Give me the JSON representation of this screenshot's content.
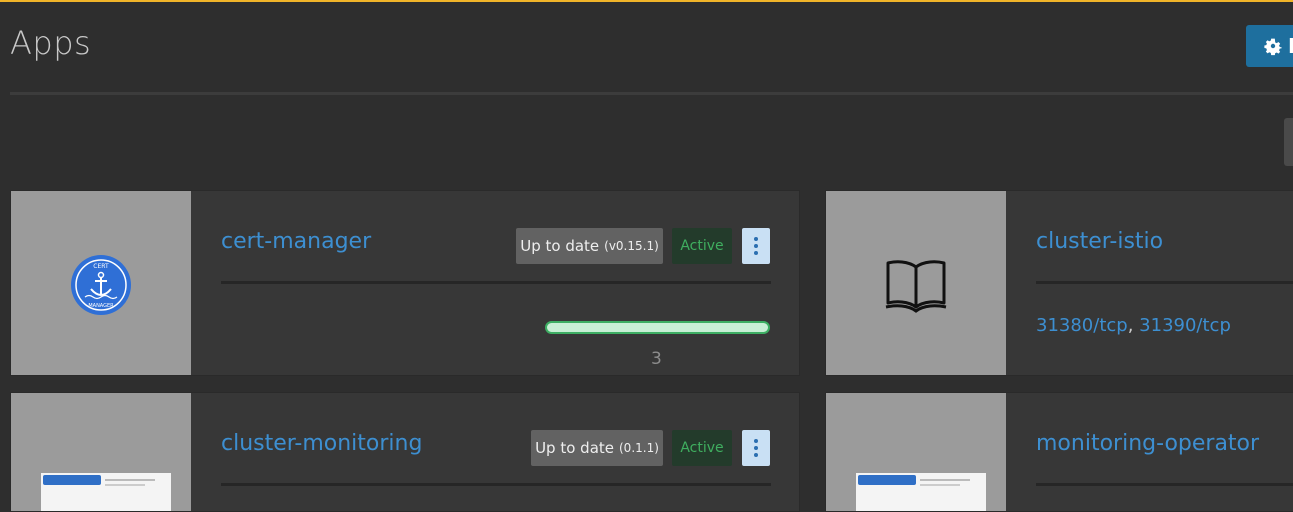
{
  "page": {
    "title": "Apps",
    "manage_label": "M"
  },
  "colors": {
    "accent": "#f0b429",
    "link": "#3d8fd1",
    "active_text": "#3fae5f",
    "button": "#1e6f9e"
  },
  "apps": [
    {
      "name": "cert-manager",
      "status": "Up to date",
      "version": "(v0.15.1)",
      "state": "Active",
      "logo": "anchor-icon",
      "logo_text_top": "CERT",
      "logo_text_bottom": "MANAGER",
      "pods_progress": 1.0,
      "pods_count": "3"
    },
    {
      "name": "cluster-istio",
      "logo": "book-icon",
      "ports": [
        "31380/tcp",
        "31390/tcp"
      ],
      "ports_sep": ", "
    },
    {
      "name": "cluster-monitoring",
      "status": "Up to date",
      "version": "(0.1.1)",
      "state": "Active",
      "logo": "screenshot-thumbnail"
    },
    {
      "name": "monitoring-operator",
      "logo": "screenshot-thumbnail"
    }
  ]
}
